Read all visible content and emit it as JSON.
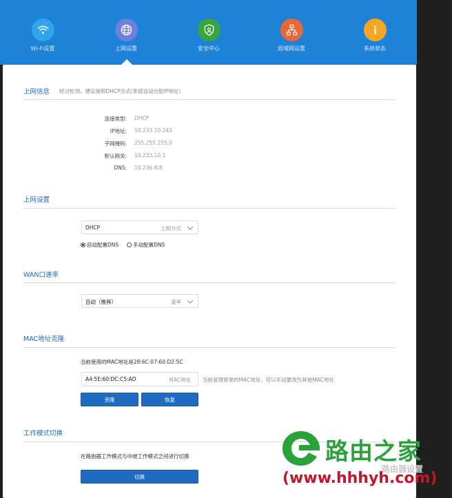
{
  "nav": {
    "items": [
      {
        "label": "Wi-Fi设置",
        "icon": "wifi-icon",
        "color": "#2fa5ec"
      },
      {
        "label": "上网设置",
        "icon": "globe-icon",
        "color": "#6f7fe0"
      },
      {
        "label": "安全中心",
        "icon": "shield-icon",
        "color": "#3aa53f"
      },
      {
        "label": "局域网设置",
        "icon": "network-icon",
        "color": "#e9683a"
      },
      {
        "label": "系统状态",
        "icon": "info-icon",
        "color": "#f5a623"
      }
    ],
    "active_index": 1
  },
  "internet_info": {
    "title": "上网信息",
    "note": "经过检测，建议使用DHCP方式(系统自动分配IP地址)",
    "rows": [
      {
        "label": "连接类型:",
        "value": "DHCP"
      },
      {
        "label": "IP地址:",
        "value": "10.233.10.243"
      },
      {
        "label": "子网掩码:",
        "value": "255.255.255.0"
      },
      {
        "label": "默认网关:",
        "value": "10.233.10.1"
      },
      {
        "label": "DNS:",
        "value": "10.236.8.8"
      }
    ]
  },
  "internet_settings": {
    "title": "上网设置",
    "mode_value": "DHCP",
    "mode_hint": "上网方式",
    "dns_auto": "自动配置DNS",
    "dns_manual": "手动配置DNS"
  },
  "wan_rate": {
    "title": "WAN口速率",
    "value": "自动（推荐）",
    "hint": "速率"
  },
  "mac_clone": {
    "title": "MAC地址克隆",
    "current_text": "当前使用的MAC地址是28:6C:07:60:D2:5C",
    "input_value": "A4:5E:60:DC:C5:AD",
    "input_hint": "MAC地址",
    "side_note": "当前管理登录的MAC地址，可以手动更改为其他MAC地址",
    "clone_button": "克隆",
    "restore_button": "恢复"
  },
  "work_mode": {
    "title": "工作模式切换",
    "text": "在路由器工作模式与中继工作模式之间进行切换",
    "switch_button": "切换"
  },
  "watermark": {
    "brand": "路由之家",
    "url": "(www.hhhyh.com)",
    "small": "路由器设置"
  }
}
